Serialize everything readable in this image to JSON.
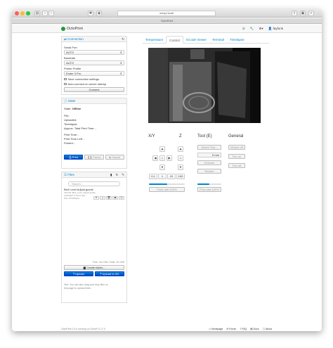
{
  "browser": {
    "url": "octopi.local",
    "tab_title": "OctoPrint"
  },
  "navbar": {
    "brand": "OctoPrint",
    "user": "fayfunk"
  },
  "connection": {
    "title": "Connection",
    "serial_port_label": "Serial Port",
    "serial_port_value": "AUTO",
    "baudrate_label": "Baudrate",
    "baudrate_value": "AUTO",
    "printer_profile_label": "Printer Profile",
    "printer_profile_value": "Ender 3 Pro",
    "save_settings_label": "Save connection settings",
    "auto_connect_label": "Auto-connect on server startup",
    "connect_button": "Connect"
  },
  "state": {
    "title": "State",
    "state_label": "State:",
    "state_value": "Offline",
    "file_label": "File:",
    "uploaded_label": "Uploaded:",
    "timelapse_label": "Timelapse:",
    "approx_time_label": "Approx. Total Print Time: -",
    "print_time_label": "Print Time: -",
    "print_time_left_label": "Print Time Left: -",
    "printed_label": "Printed: -",
    "print_button": "Print",
    "pause_button": "Pause",
    "cancel_button": "Cancel"
  },
  "files": {
    "title": "Files",
    "search_placeholder": "Search...",
    "file_name": "Bed Level Adjust.gcode",
    "file_origin": "Internal: Bed_Level_Adjust.gcode",
    "file_uploaded": "Uploaded: 3 hours ago",
    "file_size": "Size: 870.8bytes",
    "storage_info": "Free: 26.1GB / Total: 29.1GB",
    "create_folder_button": "Create folder...",
    "upload_button": "Upload",
    "upload_sd_button": "Upload to SD",
    "hint": "Hint: You can also drag and drop files on this page to upload them."
  },
  "tabs": [
    {
      "label": "Temperature"
    },
    {
      "label": "Control"
    },
    {
      "label": "GCode Viewer"
    },
    {
      "label": "Terminal"
    },
    {
      "label": "Timelapse"
    }
  ],
  "control": {
    "xy_label": "X/Y",
    "z_label": "Z",
    "tool_label": "Tool (E)",
    "general_label": "General",
    "step_values": [
      "0.1",
      "1",
      "10",
      "100"
    ],
    "feed_rate_label": "Feed rate:100%",
    "flow_rate_label": "Flow rate:100%",
    "tool_select": "Select Tool...",
    "extrude_amount": "5",
    "extrude_unit": "mm",
    "extrude_button": "Extrude",
    "retract_button": "Retract",
    "motors_off_button": "Motors off",
    "fan_on_button": "Fan on",
    "fan_off_button": "Fan off",
    "feed_rate_percent": 50,
    "flow_rate_percent": 50
  },
  "footer": {
    "version": "OctoPrint 1.5.x running on OctoPi 0.17.0",
    "links": [
      "Homepage",
      "Forum",
      "FAQ",
      "Docs",
      "About"
    ]
  },
  "colors": {
    "accent": "#0088cc",
    "brand_green": "#1f9a3b"
  }
}
